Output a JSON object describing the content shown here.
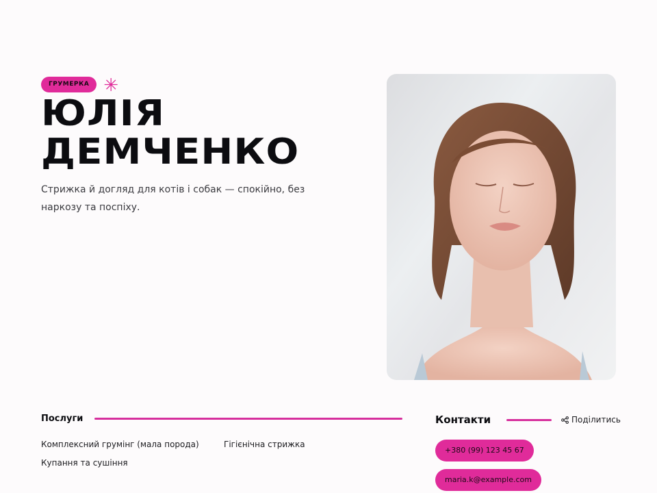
{
  "hero": {
    "badge": "ГРУМЕРКА",
    "name_line1": "ЮЛІЯ",
    "name_line2": "ДЕМЧЕНКО",
    "tagline": "Стрижка й догляд для котів і собак — спокійно, без наркозу та поспіху."
  },
  "services": {
    "title": "Послуги",
    "items": [
      "Комплексний грумінг (мала порода)",
      "Гігієнічна стрижка",
      "Купання та сушіння"
    ]
  },
  "contacts": {
    "title": "Контакти",
    "share_label": "Поділитись",
    "phone": "+380 (99) 123 45 67",
    "email": "maria.k@example.com"
  },
  "colors": {
    "accent": "#e02b9a",
    "text": "#0c0c10",
    "background": "#fdfbfc"
  },
  "icons": {
    "badge_decoration": "asterisk-icon",
    "share": "share-icon"
  }
}
